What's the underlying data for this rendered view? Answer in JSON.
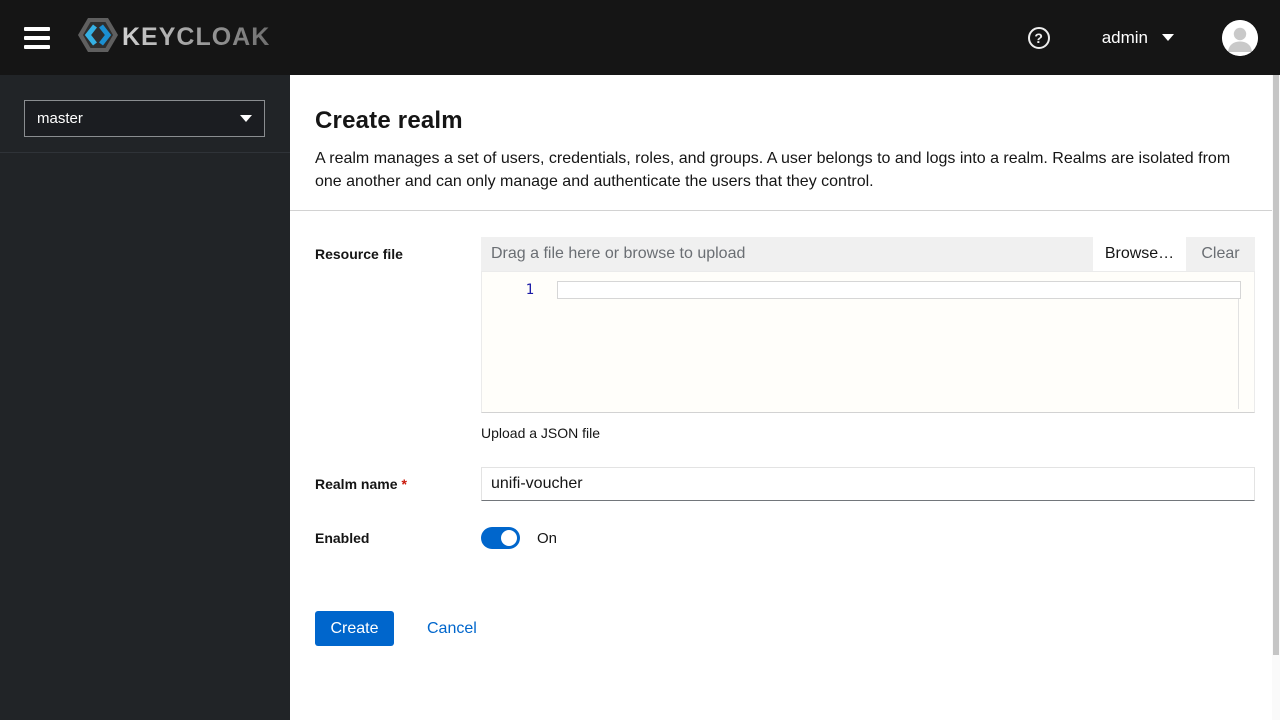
{
  "header": {
    "logo_text": "KEYCLOAK",
    "help_label": "?",
    "user_menu": {
      "label": "admin"
    }
  },
  "sidebar": {
    "realm_selector": {
      "value": "master"
    }
  },
  "page": {
    "title": "Create realm",
    "description": "A realm manages a set of users, credentials, roles, and groups. A user belongs to and logs into a realm. Realms are isolated from one another and can only manage and authenticate the users that they control."
  },
  "form": {
    "resource_file": {
      "label": "Resource file",
      "placeholder": "Drag a file here or browse to upload",
      "browse_label": "Browse…",
      "clear_label": "Clear",
      "editor_line_number": "1",
      "helper_text": "Upload a JSON file"
    },
    "realm_name": {
      "label": "Realm name",
      "required_indicator": "*",
      "value": "unifi-voucher"
    },
    "enabled": {
      "label": "Enabled",
      "state_label": "On",
      "on": true
    },
    "actions": {
      "create_label": "Create",
      "cancel_label": "Cancel"
    }
  },
  "colors": {
    "accent": "#0066cc",
    "header_bg": "#151515",
    "sidebar_bg": "#212427",
    "danger": "#c9190b",
    "upload_bg": "#f0f0f0"
  }
}
